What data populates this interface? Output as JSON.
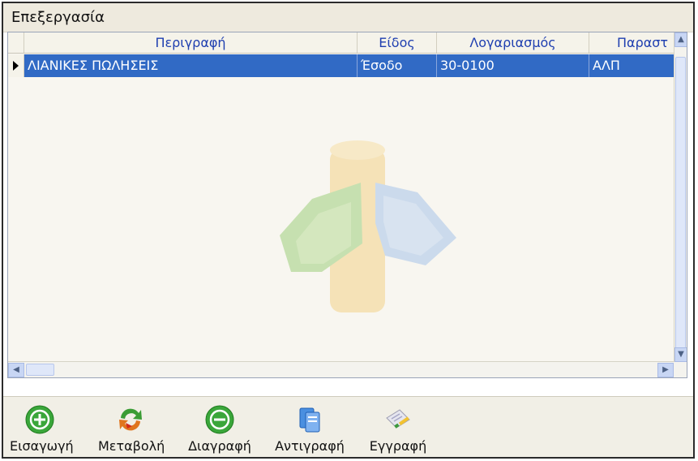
{
  "window": {
    "title": "Επεξεργασία"
  },
  "grid": {
    "columns": [
      "Περιγραφή",
      "Είδος",
      "Λογαριασμός",
      "Παραστ"
    ],
    "rows": [
      {
        "description": "ΛΙΑΝΙΚΕΣ ΠΩΛΗΣΕΙΣ",
        "type": "Έσοδο",
        "account": "30-0100",
        "doc": "ΑΛΠ"
      }
    ]
  },
  "toolbar": {
    "insert_label": "Εισαγωγή",
    "modify_label": "Μεταβολή",
    "delete_label": "Διαγραφή",
    "copy_label": "Αντιγραφή",
    "record_label": "Εγγραφή"
  },
  "colors": {
    "selection": "#316ac5",
    "header_text": "#1f3fb0"
  },
  "icons": [
    "plus-circle-icon",
    "refresh-arrows-icon",
    "minus-circle-icon",
    "copy-pages-icon",
    "document-edit-icon",
    "row-indicator-icon"
  ]
}
